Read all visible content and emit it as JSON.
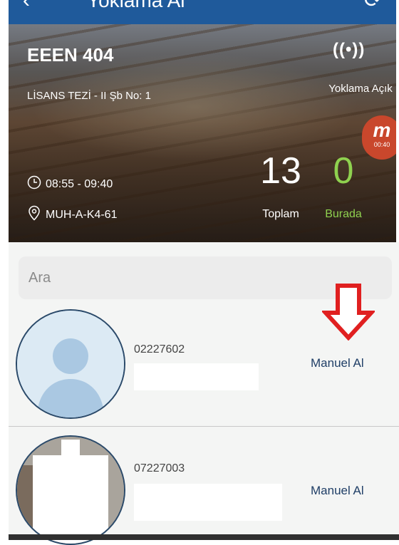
{
  "navbar": {
    "back_icon": "‹",
    "title": "Yoklama Al",
    "action_icon": "⟳"
  },
  "course": {
    "code": "EEEN 404",
    "section": "LİSANS TEZİ - II Şb No: 1",
    "time": "08:55 - 09:40",
    "room": "MUH-A-K4-61",
    "status_icon": "((•))",
    "status_label": "Yoklama Açık",
    "badge_letter": "m",
    "badge_time": "00:40",
    "total_count": "13",
    "total_label": "Toplam",
    "present_count": "0",
    "present_label": "Burada"
  },
  "search": {
    "placeholder": "Ara"
  },
  "students": [
    {
      "id": "02227602",
      "action": "Manuel Al"
    },
    {
      "id": "07227003",
      "action": "Manuel Al"
    }
  ],
  "colors": {
    "nav": "#1f5a9b",
    "present": "#8fd14f",
    "action_text": "#1f3e66",
    "arrow": "#e02020"
  }
}
